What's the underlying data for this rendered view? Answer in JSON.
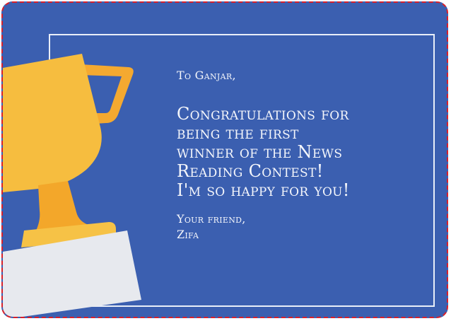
{
  "card": {
    "greeting": "To Ganjar,",
    "message_lines": "Congratulations for\nbeing the first\nwinner of the News\nReading Contest!\nI'm so happy for you!",
    "closing": "Your friend,",
    "signature": "Zifa"
  },
  "colors": {
    "background": "#3b5fb0",
    "border_dash": "#d8202a",
    "frame": "#e9eef8",
    "trophy_gold": "#f6bd3f",
    "trophy_base_gold": "#f3a72a",
    "ribbon": "#e7e9ee"
  },
  "icons": {
    "trophy": "trophy-icon"
  }
}
